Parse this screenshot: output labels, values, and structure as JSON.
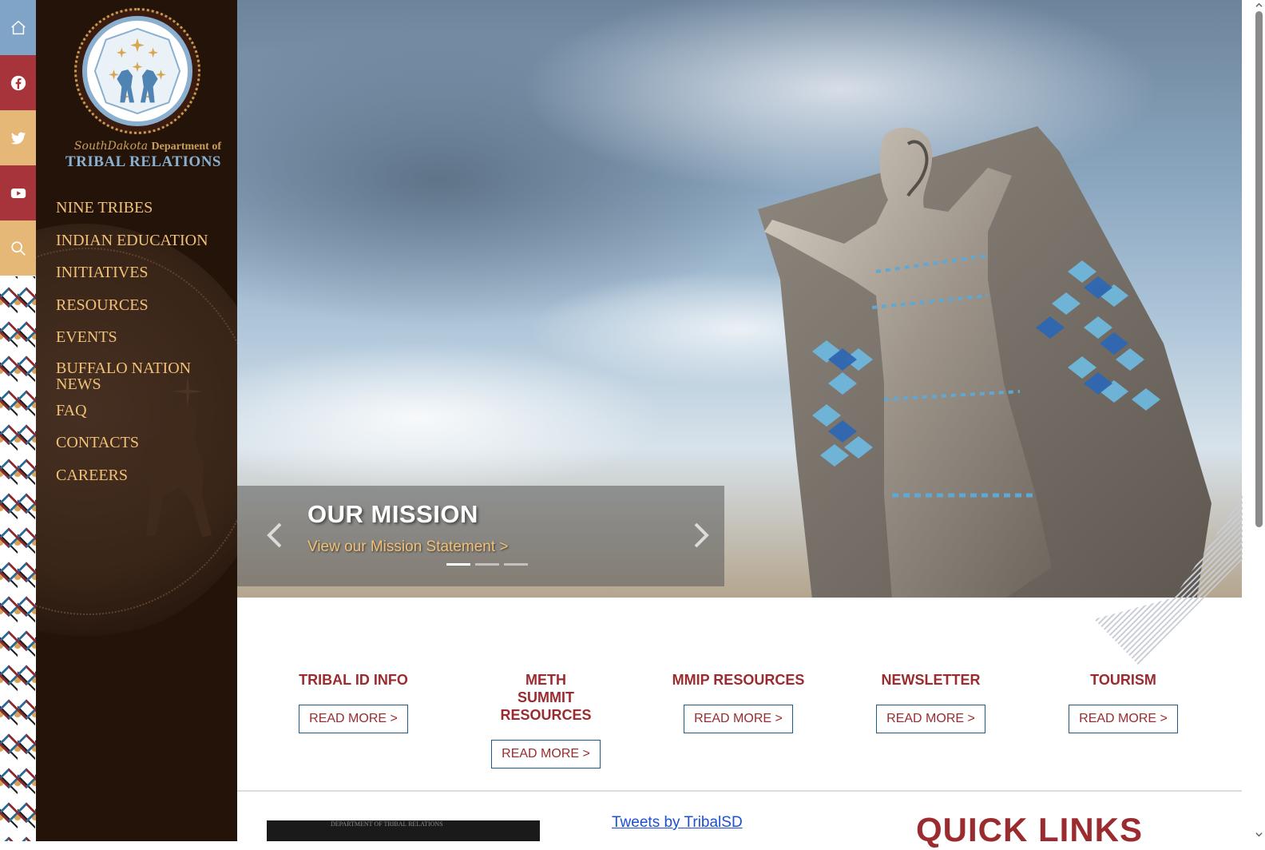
{
  "social": [
    {
      "name": "home-icon",
      "color": "#7fa4c8"
    },
    {
      "name": "facebook-icon",
      "color": "#a6343a"
    },
    {
      "name": "twitter-icon",
      "color": "#e6b877"
    },
    {
      "name": "youtube-icon",
      "color": "#a6343a"
    },
    {
      "name": "search-icon",
      "color": "#e6b877"
    }
  ],
  "logo": {
    "state": "SouthDakota",
    "department": "Department of",
    "org": "TRIBAL RELATIONS"
  },
  "nav": {
    "items": [
      "NINE TRIBES",
      "INDIAN EDUCATION",
      "INITIATIVES",
      "RESOURCES",
      "EVENTS",
      "BUFFALO NATION NEWS",
      "FAQ",
      "CONTACTS",
      "CAREERS"
    ]
  },
  "hero": {
    "title": "OUR MISSION",
    "link": "View our Mission Statement >",
    "slide_count": 3,
    "active_slide": 1
  },
  "cards": [
    {
      "title": "TRIBAL ID INFO",
      "button": "READ MORE >"
    },
    {
      "title": "METH SUMMIT RESOURCES",
      "button": "READ MORE >"
    },
    {
      "title": "MMIP RESOURCES",
      "button": "READ MORE >"
    },
    {
      "title": "NEWSLETTER",
      "button": "READ MORE >"
    },
    {
      "title": "TOURISM",
      "button": "READ MORE >"
    }
  ],
  "feed": {
    "header": "DEPARTMENT OF TRIBAL RELATIONS"
  },
  "tweets_link": "Tweets by TribalSD",
  "quick_links_title": "QUICK LINKS",
  "colors": {
    "sidebar_bg": "#231309",
    "nav_text": "#f2c178",
    "accent_red": "#9a2b2f",
    "accent_blue": "#8bb0cf"
  }
}
